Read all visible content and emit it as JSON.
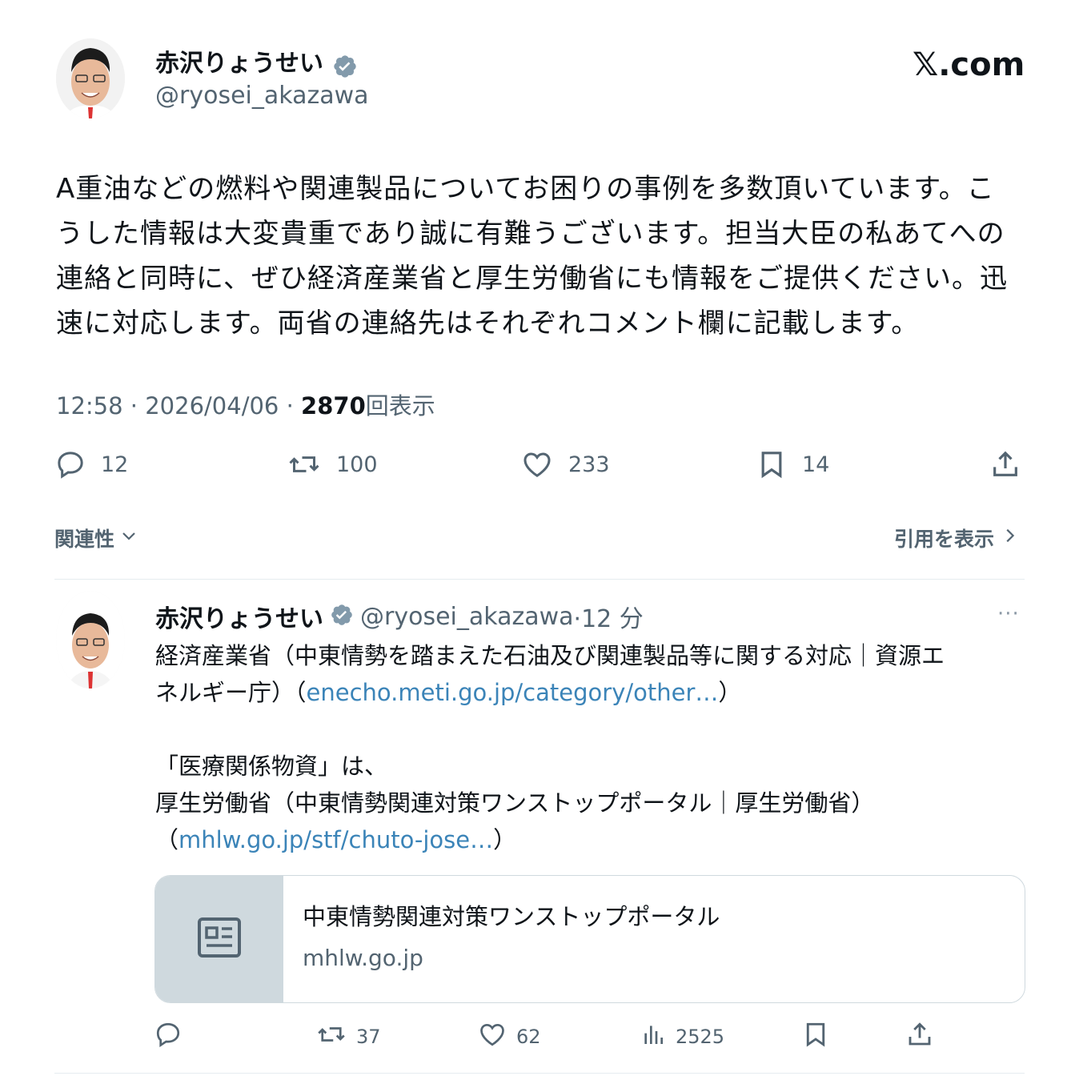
{
  "main_tweet": {
    "display_name": "赤沢りょうせい",
    "handle": "@ryosei_akazawa",
    "site_label": "𝕏.com",
    "text_lines": [
      "A重油などの燃料や関連製品についてお困りの事例を多数頂いています。こ",
      "うした情報は大変貴重であり誠に有難うございます。担当大臣の私あてへの",
      "連絡と同時に、ぜひ経済産業省と厚生労働省にも情報をご提供ください。迅",
      "速に対応します。両省の連絡先はそれぞれコメント欄に記載します。"
    ],
    "time": "12:58",
    "date": "2026/04/06",
    "views_count": "2870",
    "views_label": "回表示",
    "separator": "·",
    "stats": {
      "replies": "12",
      "reposts": "100",
      "likes": "233",
      "bookmarks": "14"
    },
    "relevance_label": "関連性",
    "quotes_label": "引用を表示"
  },
  "reply": {
    "display_name": "赤沢りょうせい",
    "handle": "@ryosei_akazawa",
    "time_ago": "·12 分",
    "more": "···",
    "line1": "経済産業省（中東情勢を踏まえた石油及び関連製品等に関する対応｜資源エ",
    "line2_pre": "ネルギー庁）（",
    "line2_link": "enecho.meti.go.jp/category/other…",
    "line2_post": "）",
    "line3": "「医療関係物資」は、",
    "line4": "厚生労働省（中東情勢関連対策ワンストップポータル｜厚生労働省）",
    "line5_pre": "（",
    "line5_link": "mhlw.go.jp/stf/chuto-jose…",
    "line5_post": "）",
    "card": {
      "title": "中東情勢関連対策ワンストップポータル",
      "domain": "mhlw.go.jp"
    },
    "stats": {
      "reposts": "37",
      "likes": "62",
      "views": "2525"
    }
  },
  "colors": {
    "text": "#0f1419",
    "secondary": "#536471",
    "link": "#3b84b8",
    "verified": "#829aab",
    "border": "#cfd9de"
  }
}
